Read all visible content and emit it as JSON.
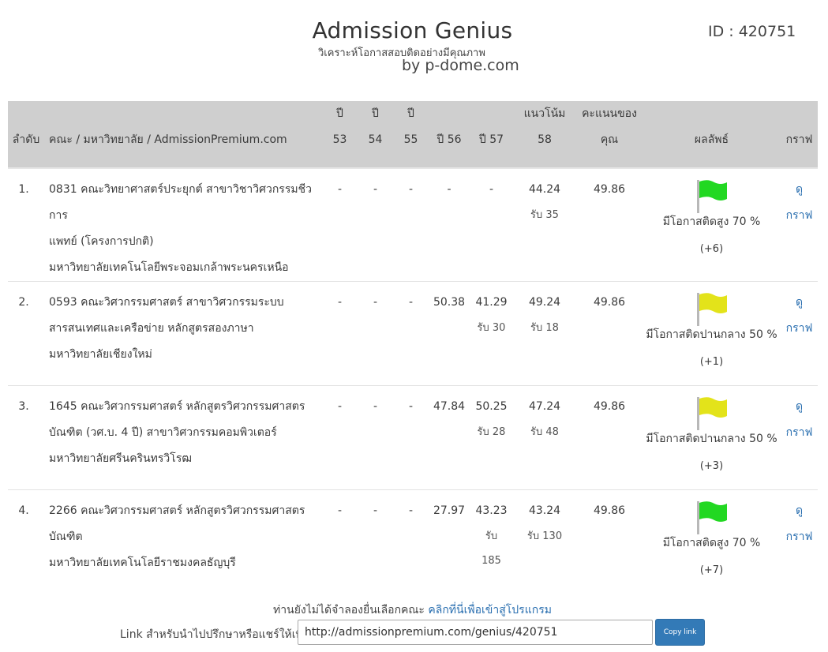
{
  "header": {
    "title": "Admission Genius",
    "subtitle": "วิเคราะห์โอกาสสอบติดอย่างมีคุณภาพ",
    "byline": "by p-dome.com",
    "id_label": "ID : 420751"
  },
  "table": {
    "columns": {
      "rank": "ลำดับ",
      "faculty": "คณะ / มหาวิทยาลัย / AdmissionPremium.com",
      "y53_top": "ปี",
      "y53_bottom": "53",
      "y54_top": "ปี",
      "y54_bottom": "54",
      "y55_top": "ปี",
      "y55_bottom": "55",
      "y56": "ปี 56",
      "y57": "ปี 57",
      "trend_top": "แนวโน้ม",
      "trend_bottom": "58",
      "score_top": "คะแนนของ",
      "score_bottom": "คุณ",
      "result": "ผลลัพธ์",
      "graph": "กราฟ"
    },
    "rows": [
      {
        "rank": "1.",
        "faculty_line1": "0831 คณะวิทยาศาสตร์ประยุกต์ สาขาวิชาวิศวกรรมชีวการ",
        "faculty_line2": "แพทย์ (โครงการปกติ)",
        "university": "มหาวิทยาลัยเทคโนโลยีพระจอมเกล้าพระนครเหนือ",
        "y53": "-",
        "y54": "-",
        "y55": "-",
        "y56": "-",
        "y57": "-",
        "y57_sub": "",
        "y57_sub2": "",
        "trend": "44.24",
        "trend_sub": "รับ 35",
        "score": "49.86",
        "flag_color": "#22d822",
        "result_text": "มีโอกาสติดสูง 70 %",
        "result_delta": "(+6)",
        "graph_line1": "ดู",
        "graph_line2": "กราฟ"
      },
      {
        "rank": "2.",
        "faculty_line1": "0593 คณะวิศวกรรมศาสตร์ สาขาวิศวกรรมระบบ",
        "faculty_line2": "สารสนเทศและเครือข่าย หลักสูตรสองภาษา",
        "university": "มหาวิทยาลัยเชียงใหม่",
        "y53": "-",
        "y54": "-",
        "y55": "-",
        "y56": "50.38",
        "y57": "41.29",
        "y57_sub": "รับ 30",
        "y57_sub2": "",
        "trend": "49.24",
        "trend_sub": "รับ 18",
        "score": "49.86",
        "flag_color": "#e3e31a",
        "result_text": "มีโอกาสติดปานกลาง 50 %",
        "result_delta": "(+1)",
        "graph_line1": "ดู",
        "graph_line2": "กราฟ"
      },
      {
        "rank": "3.",
        "faculty_line1": "1645 คณะวิศวกรรมศาสตร์ หลักสูตรวิศวกรรมศาสตร",
        "faculty_line2": "บัณฑิต (วศ.บ. 4 ปี) สาขาวิศวกรรมคอมพิวเตอร์",
        "university": "มหาวิทยาลัยศรีนครินทรวิโรฒ",
        "y53": "-",
        "y54": "-",
        "y55": "-",
        "y56": "47.84",
        "y57": "50.25",
        "y57_sub": "รับ 28",
        "y57_sub2": "",
        "trend": "47.24",
        "trend_sub": "รับ 48",
        "score": "49.86",
        "flag_color": "#e3e31a",
        "result_text": "มีโอกาสติดปานกลาง 50 %",
        "result_delta": "(+3)",
        "graph_line1": "ดู",
        "graph_line2": "กราฟ"
      },
      {
        "rank": "4.",
        "faculty_line1": "2266 คณะวิศวกรรมศาสตร์ หลักสูตรวิศวกรรมศาสตร",
        "faculty_line2": "บัณฑิต",
        "university": "มหาวิทยาลัยเทคโนโลยีราชมงคลธัญบุรี",
        "y53": "-",
        "y54": "-",
        "y55": "-",
        "y56": "27.97",
        "y57": "43.23",
        "y57_sub": "รับ",
        "y57_sub2": "185",
        "trend": "43.24",
        "trend_sub": "รับ 130",
        "score": "49.86",
        "flag_color": "#22d822",
        "result_text": "มีโอกาสติดสูง 70 %",
        "result_delta": "(+7)",
        "graph_line1": "ดู",
        "graph_line2": "กราฟ"
      }
    ]
  },
  "footer": {
    "promo_text": "ท่านยังไม่ได้จำลองยื่นเลือกคณะ",
    "promo_link": "คลิกที่นี่เพื่อเข้าสู่โปรแกรม",
    "share_label": "Link สำหรับนำไปปรึกษาหรือแชร์ให้เพื่อน",
    "share_url": "http://admissionpremium.com/genius/420751",
    "copy_button": "Copy link"
  }
}
